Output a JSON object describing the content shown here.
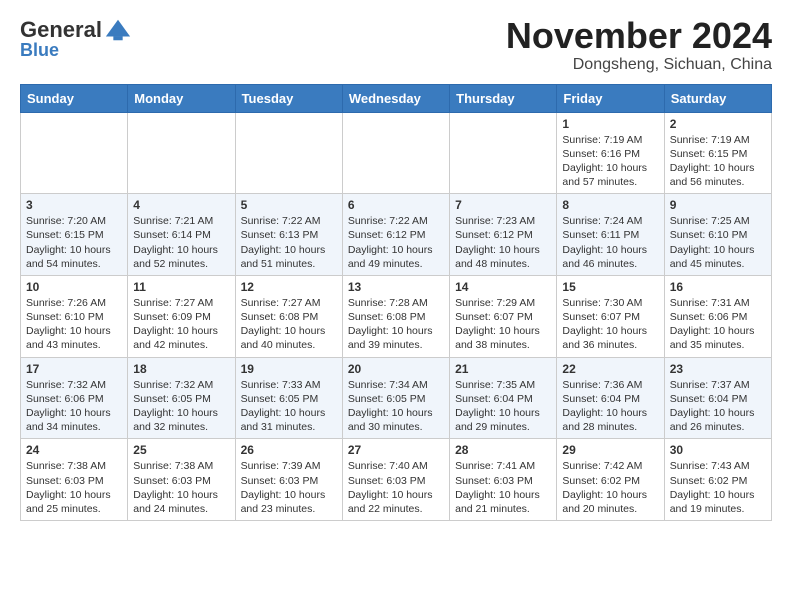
{
  "logo": {
    "general": "General",
    "blue": "Blue"
  },
  "header": {
    "month": "November 2024",
    "location": "Dongsheng, Sichuan, China"
  },
  "weekdays": [
    "Sunday",
    "Monday",
    "Tuesday",
    "Wednesday",
    "Thursday",
    "Friday",
    "Saturday"
  ],
  "weeks": [
    [
      {
        "day": "",
        "info": ""
      },
      {
        "day": "",
        "info": ""
      },
      {
        "day": "",
        "info": ""
      },
      {
        "day": "",
        "info": ""
      },
      {
        "day": "",
        "info": ""
      },
      {
        "day": "1",
        "info": "Sunrise: 7:19 AM\nSunset: 6:16 PM\nDaylight: 10 hours\nand 57 minutes."
      },
      {
        "day": "2",
        "info": "Sunrise: 7:19 AM\nSunset: 6:15 PM\nDaylight: 10 hours\nand 56 minutes."
      }
    ],
    [
      {
        "day": "3",
        "info": "Sunrise: 7:20 AM\nSunset: 6:15 PM\nDaylight: 10 hours\nand 54 minutes."
      },
      {
        "day": "4",
        "info": "Sunrise: 7:21 AM\nSunset: 6:14 PM\nDaylight: 10 hours\nand 52 minutes."
      },
      {
        "day": "5",
        "info": "Sunrise: 7:22 AM\nSunset: 6:13 PM\nDaylight: 10 hours\nand 51 minutes."
      },
      {
        "day": "6",
        "info": "Sunrise: 7:22 AM\nSunset: 6:12 PM\nDaylight: 10 hours\nand 49 minutes."
      },
      {
        "day": "7",
        "info": "Sunrise: 7:23 AM\nSunset: 6:12 PM\nDaylight: 10 hours\nand 48 minutes."
      },
      {
        "day": "8",
        "info": "Sunrise: 7:24 AM\nSunset: 6:11 PM\nDaylight: 10 hours\nand 46 minutes."
      },
      {
        "day": "9",
        "info": "Sunrise: 7:25 AM\nSunset: 6:10 PM\nDaylight: 10 hours\nand 45 minutes."
      }
    ],
    [
      {
        "day": "10",
        "info": "Sunrise: 7:26 AM\nSunset: 6:10 PM\nDaylight: 10 hours\nand 43 minutes."
      },
      {
        "day": "11",
        "info": "Sunrise: 7:27 AM\nSunset: 6:09 PM\nDaylight: 10 hours\nand 42 minutes."
      },
      {
        "day": "12",
        "info": "Sunrise: 7:27 AM\nSunset: 6:08 PM\nDaylight: 10 hours\nand 40 minutes."
      },
      {
        "day": "13",
        "info": "Sunrise: 7:28 AM\nSunset: 6:08 PM\nDaylight: 10 hours\nand 39 minutes."
      },
      {
        "day": "14",
        "info": "Sunrise: 7:29 AM\nSunset: 6:07 PM\nDaylight: 10 hours\nand 38 minutes."
      },
      {
        "day": "15",
        "info": "Sunrise: 7:30 AM\nSunset: 6:07 PM\nDaylight: 10 hours\nand 36 minutes."
      },
      {
        "day": "16",
        "info": "Sunrise: 7:31 AM\nSunset: 6:06 PM\nDaylight: 10 hours\nand 35 minutes."
      }
    ],
    [
      {
        "day": "17",
        "info": "Sunrise: 7:32 AM\nSunset: 6:06 PM\nDaylight: 10 hours\nand 34 minutes."
      },
      {
        "day": "18",
        "info": "Sunrise: 7:32 AM\nSunset: 6:05 PM\nDaylight: 10 hours\nand 32 minutes."
      },
      {
        "day": "19",
        "info": "Sunrise: 7:33 AM\nSunset: 6:05 PM\nDaylight: 10 hours\nand 31 minutes."
      },
      {
        "day": "20",
        "info": "Sunrise: 7:34 AM\nSunset: 6:05 PM\nDaylight: 10 hours\nand 30 minutes."
      },
      {
        "day": "21",
        "info": "Sunrise: 7:35 AM\nSunset: 6:04 PM\nDaylight: 10 hours\nand 29 minutes."
      },
      {
        "day": "22",
        "info": "Sunrise: 7:36 AM\nSunset: 6:04 PM\nDaylight: 10 hours\nand 28 minutes."
      },
      {
        "day": "23",
        "info": "Sunrise: 7:37 AM\nSunset: 6:04 PM\nDaylight: 10 hours\nand 26 minutes."
      }
    ],
    [
      {
        "day": "24",
        "info": "Sunrise: 7:38 AM\nSunset: 6:03 PM\nDaylight: 10 hours\nand 25 minutes."
      },
      {
        "day": "25",
        "info": "Sunrise: 7:38 AM\nSunset: 6:03 PM\nDaylight: 10 hours\nand 24 minutes."
      },
      {
        "day": "26",
        "info": "Sunrise: 7:39 AM\nSunset: 6:03 PM\nDaylight: 10 hours\nand 23 minutes."
      },
      {
        "day": "27",
        "info": "Sunrise: 7:40 AM\nSunset: 6:03 PM\nDaylight: 10 hours\nand 22 minutes."
      },
      {
        "day": "28",
        "info": "Sunrise: 7:41 AM\nSunset: 6:03 PM\nDaylight: 10 hours\nand 21 minutes."
      },
      {
        "day": "29",
        "info": "Sunrise: 7:42 AM\nSunset: 6:02 PM\nDaylight: 10 hours\nand 20 minutes."
      },
      {
        "day": "30",
        "info": "Sunrise: 7:43 AM\nSunset: 6:02 PM\nDaylight: 10 hours\nand 19 minutes."
      }
    ]
  ]
}
